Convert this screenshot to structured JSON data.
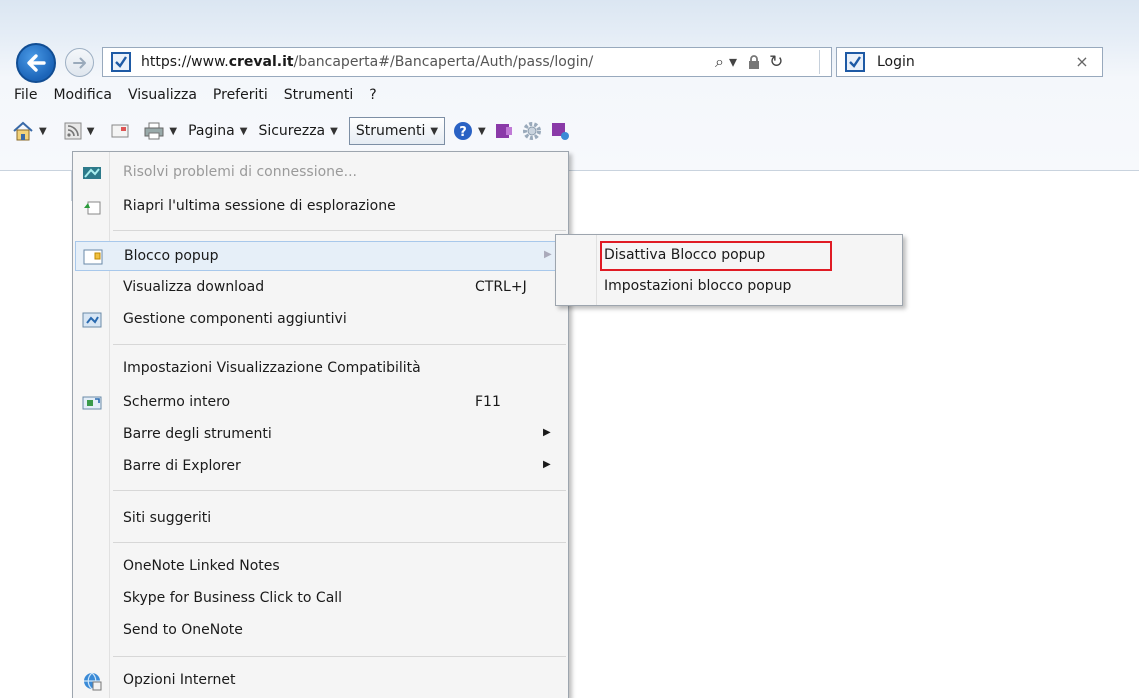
{
  "browser": {
    "url_prefix": "https://www.",
    "url_domain": "creval.it",
    "url_path": "/bancaperta#/Bancaperta/Auth/pass/login/",
    "tab_title": "Login",
    "tab_close": "×",
    "search_glyph": "⌕ ▾",
    "refresh_glyph": "↻"
  },
  "menubar": {
    "items": [
      "File",
      "Modifica",
      "Visualizza",
      "Preferiti",
      "Strumenti",
      "?"
    ]
  },
  "commandbar": {
    "pagina": "Pagina",
    "sicurezza": "Sicurezza",
    "strumenti": "Strumenti",
    "caret": "▼"
  },
  "menu": {
    "items": [
      {
        "label": "Risolvi problemi di connessione...",
        "disabled": true,
        "icon": "network-diagnose-icon"
      },
      {
        "label": "Riapri l'ultima sessione di esplorazione",
        "icon": "reopen-session-icon"
      },
      {
        "label": "Blocco popup",
        "icon": "popup-blocker-icon",
        "submenu": true
      },
      {
        "label": "Visualizza download",
        "shortcut": "CTRL+J"
      },
      {
        "label": "Gestione componenti aggiuntivi",
        "icon": "addons-icon"
      },
      {
        "label": "Impostazioni Visualizzazione Compatibilità"
      },
      {
        "label": "Schermo intero",
        "shortcut": "F11",
        "icon": "fullscreen-icon"
      },
      {
        "label": "Barre degli strumenti",
        "submenu": true
      },
      {
        "label": "Barre di Explorer",
        "submenu": true
      },
      {
        "label": "Siti suggeriti"
      },
      {
        "label": "OneNote Linked Notes"
      },
      {
        "label": "Skype for Business Click to Call"
      },
      {
        "label": "Send to OneNote"
      },
      {
        "label": "Opzioni Internet",
        "icon": "internet-options-icon"
      }
    ],
    "arrow_glyph": "▶"
  },
  "submenu": {
    "items": [
      "Disattiva Blocco popup",
      "Impostazioni blocco popup"
    ]
  },
  "colors": {
    "highlight": "#e01b24",
    "brand_blue": "#1b64b8"
  }
}
